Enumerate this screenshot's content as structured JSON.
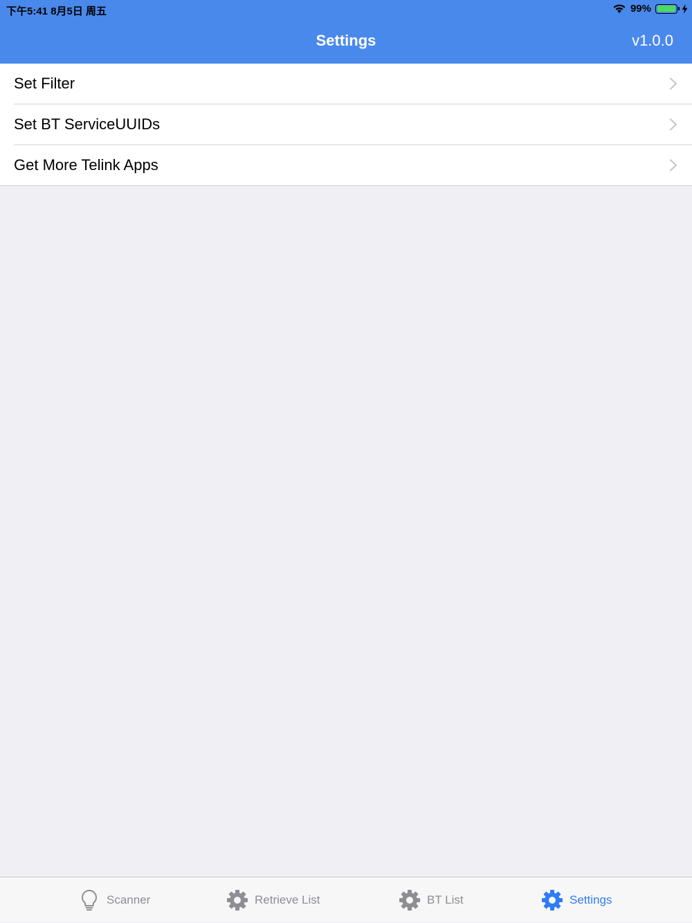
{
  "status_bar": {
    "time": "下午5:41   8月5日 周五",
    "battery_percent": "99%"
  },
  "nav": {
    "title": "Settings",
    "version": "v1.0.0"
  },
  "settings_rows": [
    {
      "label": "Set Filter"
    },
    {
      "label": "Set BT ServiceUUIDs"
    },
    {
      "label": "Get More Telink Apps"
    }
  ],
  "tabbar": {
    "tabs": [
      {
        "label": "Scanner",
        "icon": "lightbulb-icon",
        "active": false
      },
      {
        "label": "Retrieve List",
        "icon": "gear-icon",
        "active": false
      },
      {
        "label": "BT List",
        "icon": "gear-icon",
        "active": false
      },
      {
        "label": "Settings",
        "icon": "gear-icon",
        "active": true
      }
    ]
  },
  "colors": {
    "nav_bar": "#4a89ec",
    "active_tab": "#2f7cf6",
    "inactive_tab": "#8e8e93",
    "background": "#efeff4",
    "battery_fill": "#4cd964"
  }
}
